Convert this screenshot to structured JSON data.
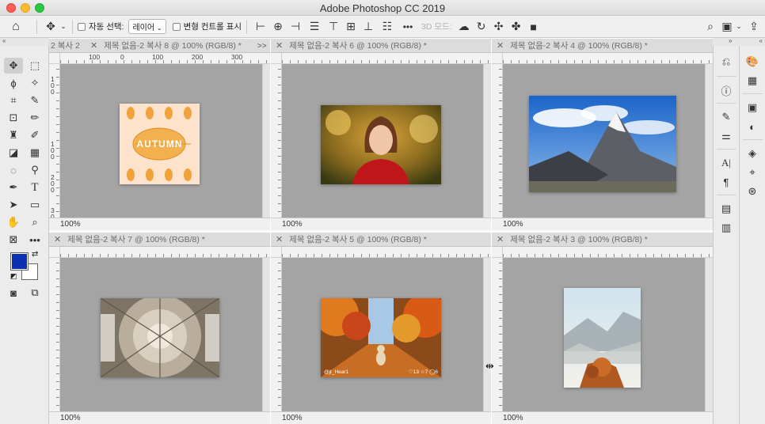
{
  "window": {
    "title": "Adobe Photoshop CC 2019"
  },
  "options_bar": {
    "auto_select_label": "자동 선택:",
    "auto_select_value": "레이어",
    "transform_controls_label": "변형 컨트롤 표시",
    "more_label": "•••",
    "mode_3d_label": "3D 모드:"
  },
  "tab_strip_overflow": {
    "label": "2 복사 2",
    "more": ">>"
  },
  "documents": [
    {
      "tab": "제목 없음-2 복사 8 @ 100% (RGB/8) *",
      "zoom": "100%",
      "ruler_top": [
        "100",
        "0",
        "100",
        "200",
        "300"
      ],
      "ruler_left": [
        "1",
        "0",
        "0",
        "1",
        "0",
        "0",
        "2",
        "0",
        "0",
        "3",
        "0",
        "0"
      ],
      "image": "autumn",
      "image_text": "AUTUMN"
    },
    {
      "tab": "제목 없음-2 복사 6 @ 100% (RGB/8) *",
      "zoom": "100%",
      "image": "portrait"
    },
    {
      "tab": "제목 없음-2 복사 4 @ 100% (RGB/8) *",
      "zoom": "100%",
      "image": "mountain"
    },
    {
      "tab": "제목 없음-2 복사 7 @ 100% (RGB/8) *",
      "zoom": "100%",
      "image": "dome"
    },
    {
      "tab": "제목 없음-2 복사 5 @ 100% (RGB/8) *",
      "zoom": "100%",
      "image": "autumn-dog",
      "overlay_left": "@jt_Hear1",
      "overlay_right": "♡13  ☆7  ◯6"
    },
    {
      "tab": "제목 없음-2 복사 3 @ 100% (RGB/8) *",
      "zoom": "100%",
      "image": "foggy-hills"
    }
  ],
  "colors": {
    "foreground": "#0a2fb0",
    "background": "#ffffff",
    "canvas": "#a4a4a4"
  },
  "icons": {
    "right_panel_1": [
      "history-icon",
      "info-icon",
      "brush-settings-icon",
      "adjust-sliders-icon",
      "character-icon",
      "paragraph-icon",
      "properties-icon",
      "notes-icon"
    ],
    "right_panel_2": [
      "color-icon",
      "swatches-icon",
      "libraries-icon",
      "adjustments-icon",
      "layers-icon",
      "paths-icon",
      "channels-icon"
    ]
  }
}
